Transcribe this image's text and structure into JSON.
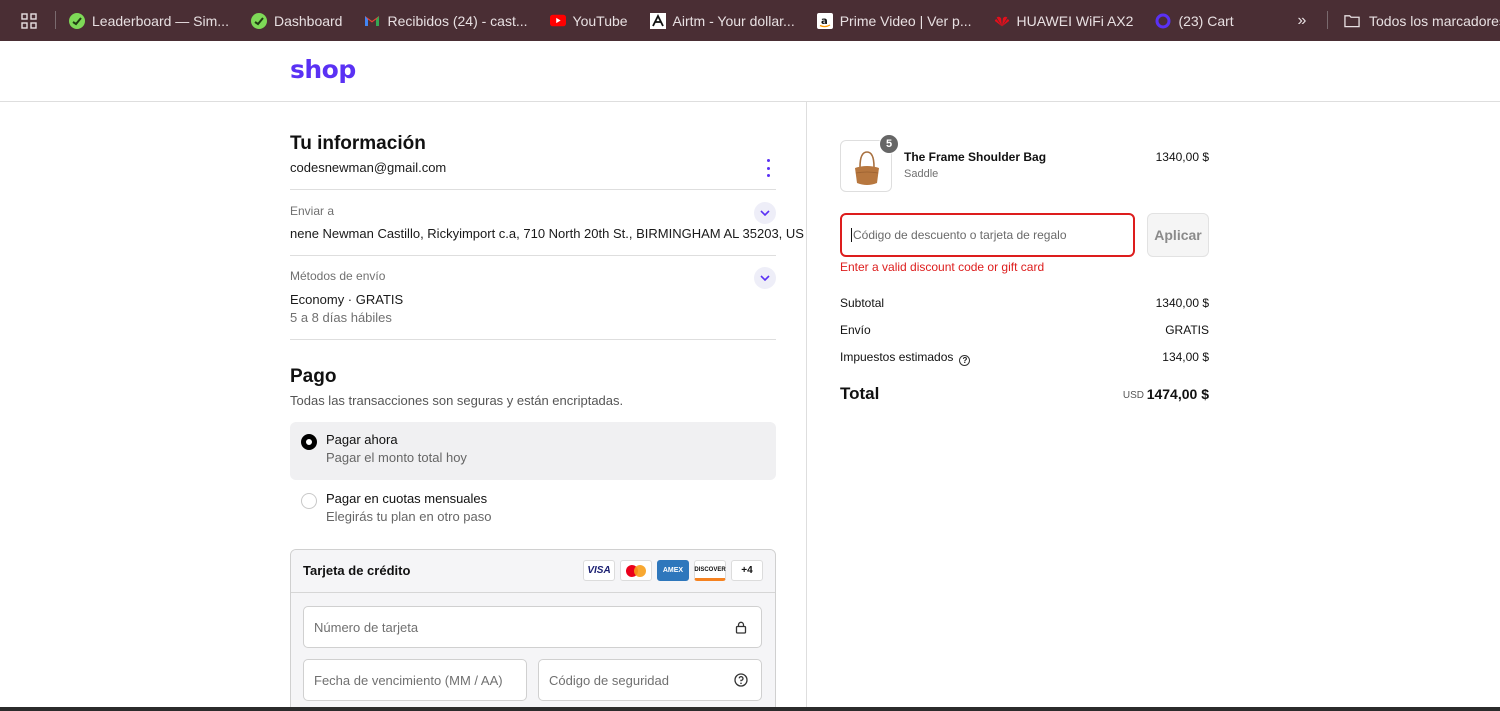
{
  "bookmarks": {
    "items": [
      {
        "label": "Leaderboard — Sim...",
        "icon": "leaderboard-favicon"
      },
      {
        "label": "Dashboard",
        "icon": "dashboard-favicon"
      },
      {
        "label": "Recibidos (24) - cast...",
        "icon": "gmail-icon"
      },
      {
        "label": "YouTube",
        "icon": "youtube-icon"
      },
      {
        "label": "Airtm - Your dollar...",
        "icon": "airtm-icon"
      },
      {
        "label": "Prime Video | Ver p...",
        "icon": "amazon-icon"
      },
      {
        "label": "HUAWEI WiFi AX2",
        "icon": "huawei-icon"
      },
      {
        "label": "(23) Cart",
        "icon": "cart-favicon"
      }
    ],
    "more": "»",
    "folder_label": "Todos los marcadores"
  },
  "header": {
    "logo": "shop"
  },
  "info": {
    "title": "Tu información",
    "email": "codesnewman@gmail.com"
  },
  "shipping": {
    "label": "Enviar a",
    "address": "nene Newman Castillo, Rickyimport c.a, 710 North 20th St., BIRMINGHAM AL 35203, US"
  },
  "methods": {
    "label": "Métodos de envío",
    "value": "Economy · GRATIS",
    "days": "5 a 8 días hábiles"
  },
  "payment": {
    "title": "Pago",
    "subtitle": "Todas las transacciones son seguras y están encriptadas.",
    "options": [
      {
        "label": "Pagar ahora",
        "desc": "Pagar el monto total hoy",
        "selected": true
      },
      {
        "label": "Pagar en cuotas mensuales",
        "desc": "Elegirás tu plan en otro paso",
        "selected": false
      }
    ],
    "card": {
      "title": "Tarjeta de crédito",
      "brands": [
        "VISA",
        "AMEX",
        "DISCOVER",
        "+4"
      ],
      "number_placeholder": "Número de tarjeta",
      "expiry_placeholder": "Fecha de vencimiento (MM / AA)",
      "cvc_placeholder": "Código de seguridad"
    }
  },
  "order": {
    "product_name": "The Frame Shoulder Bag",
    "variant": "Saddle",
    "price": "1340,00 $",
    "quantity": "5",
    "discount_placeholder": "Código de descuento o tarjeta de regalo",
    "apply_label": "Aplicar",
    "error": "Enter a valid discount code or gift card",
    "subtotal_label": "Subtotal",
    "subtotal_value": "1340,00 $",
    "shipping_label": "Envío",
    "shipping_value": "GRATIS",
    "tax_label": "Impuestos estimados",
    "tax_value": "134,00 $",
    "total_label": "Total",
    "currency": "USD",
    "total_value": "1474,00 $"
  },
  "colors": {
    "brand": "#5a31f4",
    "error": "#dd1d1d",
    "bookmark_bar": "#4a2e34"
  }
}
